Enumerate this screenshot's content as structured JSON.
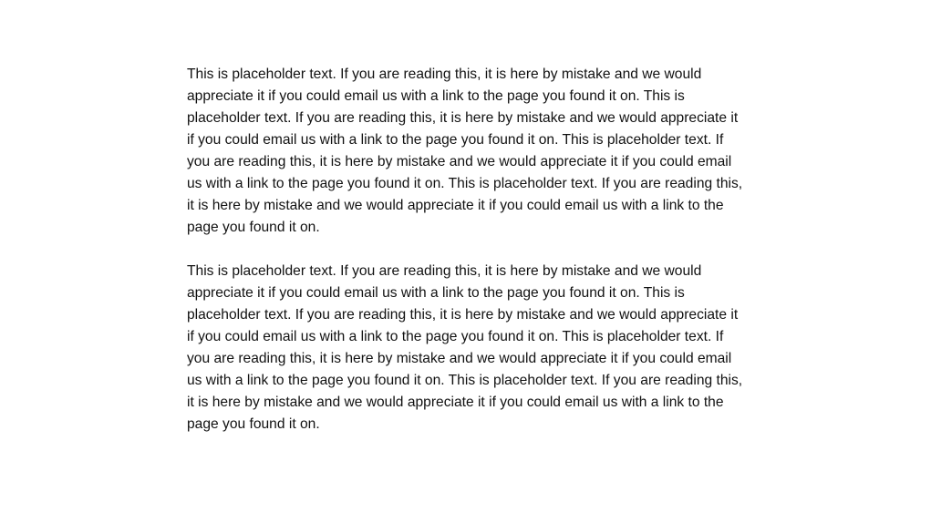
{
  "paragraphs": [
    "This is placeholder text. If you are reading this, it is here by mistake and we would appreciate it if you could email us with a link to the page you found it on. This is placeholder text. If you are reading this, it is here by mistake and we would appreciate it if you could email us with a link to the page you found it on. This is placeholder text. If you are reading this, it is here by mistake and we would appreciate it if you could email us with a link to the page you found it on. This is placeholder text. If you are reading this, it is here by mistake and we would appreciate it if you could email us with a link to the page you found it on.",
    "This is placeholder text. If you are reading this, it is here by mistake and we would appreciate it if you could email us with a link to the page you found it on. This is placeholder text. If you are reading this, it is here by mistake and we would appreciate it if you could email us with a link to the page you found it on. This is placeholder text. If you are reading this, it is here by mistake and we would appreciate it if you could email us with a link to the page you found it on. This is placeholder text. If you are reading this, it is here by mistake and we would appreciate it if you could email us with a link to the page you found it on."
  ]
}
